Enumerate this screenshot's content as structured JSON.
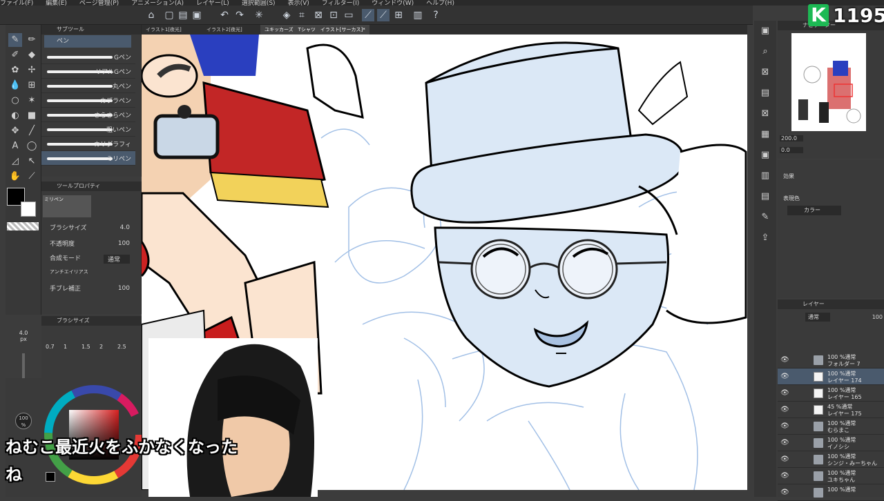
{
  "menu": [
    "ファイル(F)",
    "編集(E)",
    "ページ管理(P)",
    "アニメーション(A)",
    "レイヤー(L)",
    "選択範囲(S)",
    "表示(V)",
    "フィルター(I)",
    "ウィンドウ(W)",
    "ヘルプ(H)"
  ],
  "tabs": [
    {
      "label": "イラスト1[夜光]"
    },
    {
      "label": "イラスト2[夜光]"
    },
    {
      "label": "ユキッカーズ　Tシャツ　イラスト[サーカス]*"
    }
  ],
  "subtool": {
    "header": "サブツール",
    "active_tool": "ペン",
    "brushes": [
      "Gペン",
      "リアルGペン",
      "丸ペン",
      "カブラペン",
      "さらさらペン",
      "粗いペン",
      "カリグラフィ",
      "ミリペン"
    ],
    "selected_index": 7
  },
  "tool_property": {
    "header": "ツールプロパティ",
    "preview_name": "ミリペン",
    "brush_size_label": "ブラシサイズ",
    "brush_size_value": "4.0",
    "opacity_label": "不透明度",
    "opacity_value": "100",
    "blend_label": "合成モード",
    "blend_value": "通常",
    "antialias_label": "アンチエイリアス",
    "stabilization_label": "手ブレ補正",
    "stabilization_value": "100"
  },
  "brush_size_panel": {
    "header": "ブラシサイズ",
    "current": "4.0",
    "unit": "px",
    "presets": [
      "0.7",
      "1",
      "1.5",
      "2",
      "2.5"
    ]
  },
  "color": {
    "opacity_label": "100",
    "opacity_unit": "%",
    "main": "#000000",
    "sub": "#ffffff"
  },
  "navigator": {
    "header": "ナビゲーター",
    "zoom": "200.0",
    "rotation": "0.0"
  },
  "effect": {
    "label": "効果",
    "display_color_label": "表現色",
    "display_color_value": "カラー"
  },
  "layers": {
    "header": "レイヤー",
    "blend": "通常",
    "opacity": "100",
    "rows": [
      {
        "top": "100 %通常",
        "name": "フォルダー 7",
        "type": "folder"
      },
      {
        "top": "100 %通常",
        "name": "レイヤー 174",
        "type": "layer",
        "selected": true
      },
      {
        "top": "100 %通常",
        "name": "レイヤー 165",
        "type": "layer"
      },
      {
        "top": "45 %通常",
        "name": "レイヤー 175",
        "type": "layer"
      },
      {
        "top": "100 %通常",
        "name": "むらまこ",
        "type": "folder"
      },
      {
        "top": "100 %通常",
        "name": "イノシシ",
        "type": "folder"
      },
      {
        "top": "100 %通常",
        "name": "シンジ・みーちゃん",
        "type": "folder"
      },
      {
        "top": "100 %通常",
        "name": "ユキちゃん",
        "type": "folder"
      },
      {
        "top": "100 %通常",
        "name": "",
        "type": "folder"
      }
    ]
  },
  "overlay": {
    "badge_letter": "K",
    "viewer_count": "1195",
    "subtitle_line1": "ねむこ最近火をふかなくなった",
    "subtitle_line2": "ね",
    "accent": "#1db954"
  }
}
